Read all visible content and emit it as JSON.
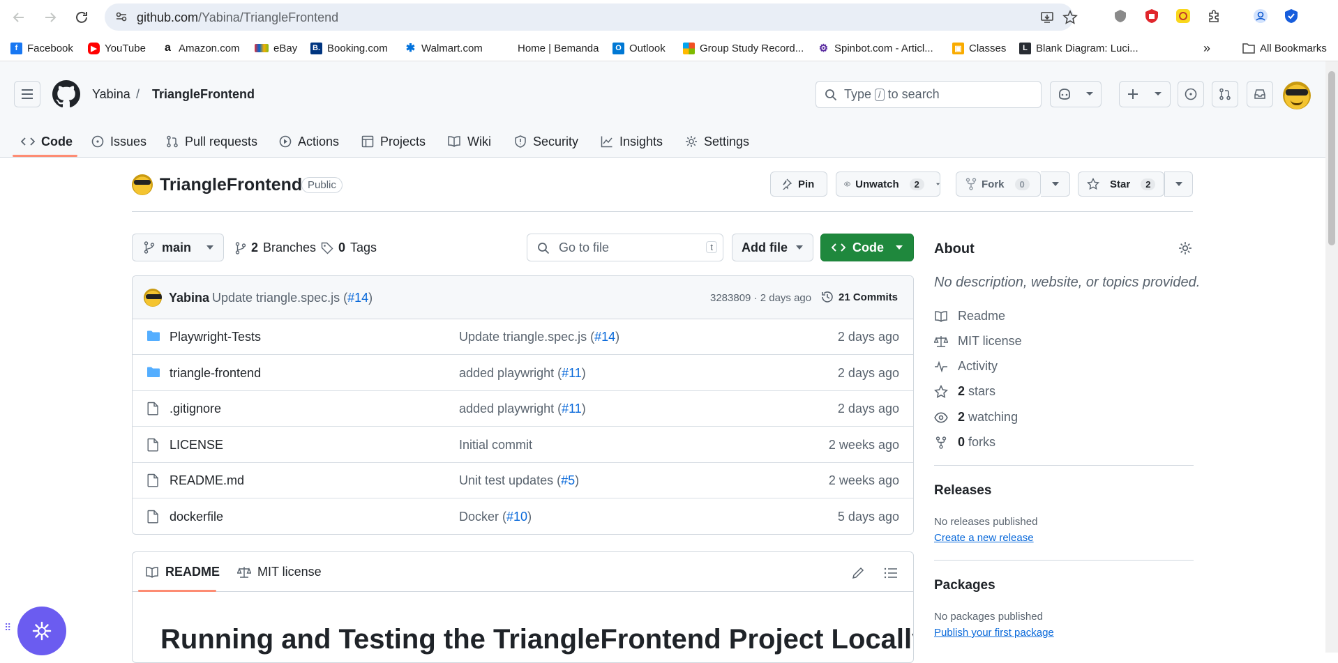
{
  "browser": {
    "url_host": "github.com",
    "url_path": "/Yabina/TriangleFrontend",
    "bookmarks": [
      "Facebook",
      "YouTube",
      "Amazon.com",
      "eBay",
      "Booking.com",
      "Walmart.com",
      "Home | Bemanda",
      "Outlook",
      "Group Study Record...",
      "Spinbot.com - Articl...",
      "Classes",
      "Blank Diagram: Luci..."
    ],
    "overflow": "»",
    "all_bookmarks": "All Bookmarks"
  },
  "header": {
    "owner": "Yabina",
    "separator": "/",
    "repo": "TriangleFrontend",
    "search_prefix": "Type",
    "search_key": "/",
    "search_suffix": "to search"
  },
  "tabs": [
    "Code",
    "Issues",
    "Pull requests",
    "Actions",
    "Projects",
    "Wiki",
    "Security",
    "Insights",
    "Settings"
  ],
  "repo": {
    "title": "TriangleFrontend",
    "visibility": "Public",
    "pin": "Pin",
    "unwatch": "Unwatch",
    "watch_count": "2",
    "fork": "Fork",
    "fork_count": "0",
    "star": "Star",
    "star_count": "2"
  },
  "toolbar": {
    "branch": "main",
    "branches_count": "2",
    "branches_label": "Branches",
    "tags_count": "0",
    "tags_label": "Tags",
    "goto_placeholder": "Go to file",
    "goto_key": "t",
    "add_file": "Add file",
    "code": "Code"
  },
  "latest_commit": {
    "author": "Yabina",
    "message": "Update triangle.spec.js (",
    "pr": "#14",
    "close": ")",
    "meta": "3283809 · 2 days ago",
    "commits": "21 Commits"
  },
  "files": [
    {
      "name": "Playwright-Tests",
      "type": "folder",
      "msg": "Update triangle.spec.js (",
      "pr": "#14",
      "close": ")",
      "date": "2 days ago"
    },
    {
      "name": "triangle-frontend",
      "type": "folder",
      "msg": "added playwright (",
      "pr": "#11",
      "close": ")",
      "date": "2 days ago"
    },
    {
      "name": ".gitignore",
      "type": "file",
      "msg": "added playwright (",
      "pr": "#11",
      "close": ")",
      "date": "2 days ago"
    },
    {
      "name": "LICENSE",
      "type": "file",
      "msg": "Initial commit",
      "pr": "",
      "close": "",
      "date": "2 weeks ago"
    },
    {
      "name": "README.md",
      "type": "file",
      "msg": "Unit test updates (",
      "pr": "#5",
      "close": ")",
      "date": "2 weeks ago"
    },
    {
      "name": "dockerfile",
      "type": "file",
      "msg": "Docker (",
      "pr": "#10",
      "close": ")",
      "date": "5 days ago"
    }
  ],
  "readme": {
    "tab_readme": "README",
    "tab_license": "MIT license",
    "heading": "Running and Testing the TriangleFrontend Project Locally"
  },
  "about": {
    "title": "About",
    "description": "No description, website, or topics provided.",
    "readme": "Readme",
    "license": "MIT license",
    "activity": "Activity",
    "stars_count": "2",
    "stars_label": "stars",
    "watching_count": "2",
    "watching_label": "watching",
    "forks_count": "0",
    "forks_label": "forks"
  },
  "releases": {
    "title": "Releases",
    "none": "No releases published",
    "create": "Create a new release"
  },
  "packages": {
    "title": "Packages",
    "none": "No packages published",
    "publish": "Publish your first package"
  },
  "colors": {
    "accent_green": "#1f883d",
    "link_blue": "#0969da",
    "tab_underline": "#fd8c73",
    "folder_blue": "#54aeff"
  }
}
